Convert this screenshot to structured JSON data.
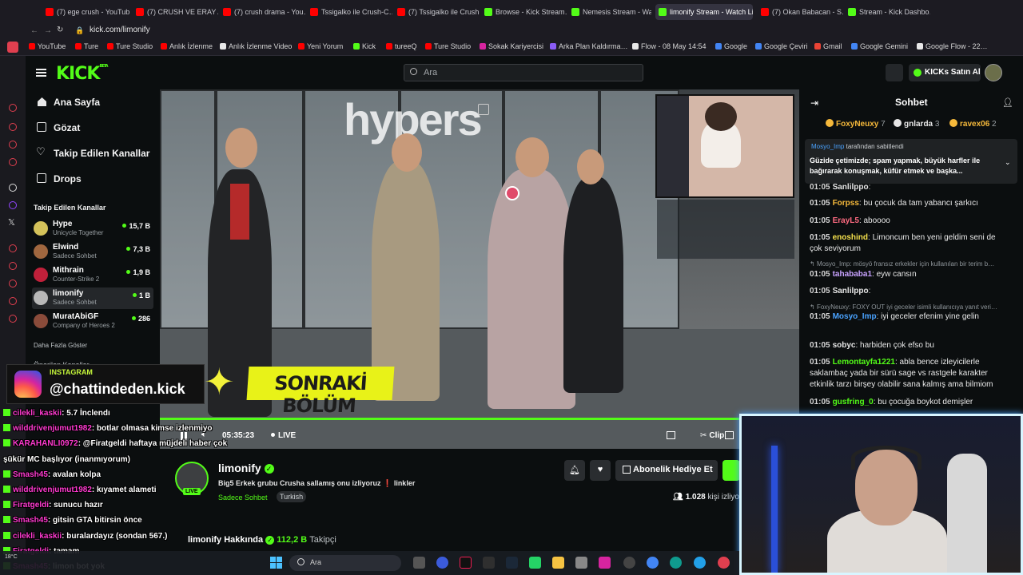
{
  "browser": {
    "tabs": [
      {
        "label": "(7) ege crush - YouTube",
        "color": "#ff0000"
      },
      {
        "label": "(7) CRUSH VE ERAY A…",
        "color": "#ff0000"
      },
      {
        "label": "(7) crush drama - You…",
        "color": "#ff0000"
      },
      {
        "label": "Tssigalko ile Crush-C…",
        "color": "#ff0000"
      },
      {
        "label": "(7) Tssigalko ile Crush…",
        "color": "#ff0000"
      },
      {
        "label": "Browse - Kick Stream…",
        "color": "#53fc18"
      },
      {
        "label": "Nemesis Stream - Wa…",
        "color": "#53fc18"
      },
      {
        "label": "limonify Stream - Watch Li…",
        "color": "#53fc18"
      },
      {
        "label": "(7) Okan Babacan - S…",
        "color": "#ff0000"
      },
      {
        "label": "Stream - Kick Dashbo…",
        "color": "#53fc18"
      }
    ],
    "url": "kick.com/limonify",
    "bookmarks": [
      {
        "label": "YouTube",
        "color": "#ff0000"
      },
      {
        "label": "Ture",
        "color": "#ff0000"
      },
      {
        "label": "Ture Studio",
        "color": "#ff0000"
      },
      {
        "label": "Anlık İzlenme",
        "color": "#ff0000"
      },
      {
        "label": "Anlık İzlenme Video",
        "color": "#e8e8e8"
      },
      {
        "label": "Yeni Yorum",
        "color": "#ff0000"
      },
      {
        "label": "Kick",
        "color": "#53fc18"
      },
      {
        "label": "tureeQ",
        "color": "#ff0000"
      },
      {
        "label": "Ture Studio",
        "color": "#ff0000"
      },
      {
        "label": "Sokak Kariyercisi",
        "color": "#d6249f"
      },
      {
        "label": "Arka Plan Kaldırma…",
        "color": "#8a5cf6"
      },
      {
        "label": "Flow - 08 May 14:54",
        "color": "#e8e8e8"
      },
      {
        "label": "Google",
        "color": "#4285f4"
      },
      {
        "label": "Google Çeviri",
        "color": "#4285f4"
      },
      {
        "label": "Gmail",
        "color": "#ea4335"
      },
      {
        "label": "Google Gemini",
        "color": "#4285f4"
      },
      {
        "label": "Google Flow - 22…",
        "color": "#e8e8e8"
      }
    ]
  },
  "header": {
    "logo": "KICK",
    "logo_badge": "BETA",
    "search_placeholder": "Ara",
    "buy_label": "KICKs Satın Al"
  },
  "sidebar": {
    "nav": [
      "Ana Sayfa",
      "Gözat",
      "Takip Edilen Kanallar",
      "Drops"
    ],
    "followed_title": "Takip Edilen Kanallar",
    "channels": [
      {
        "name": "Hype",
        "game": "Unicycle Together",
        "viewers": "15,7 B",
        "color": "#d4c25a"
      },
      {
        "name": "Elwind",
        "game": "Sadece Sohbet",
        "viewers": "7,3 B",
        "color": "#a0673f"
      },
      {
        "name": "Mithrain",
        "game": "Counter-Strike 2",
        "viewers": "1,9 B",
        "color": "#c0203a"
      },
      {
        "name": "limonify",
        "game": "Sadece Sohbet",
        "viewers": "1 B",
        "color": "#b8b8b8"
      },
      {
        "name": "MuratAbiGF",
        "game": "Company of Heroes 2",
        "viewers": "286",
        "color": "#8a4b3a"
      }
    ],
    "more": "Daha Fazla Göster",
    "suggested_title": "Önerilen Kanallar"
  },
  "player": {
    "time": "05:35:23",
    "live": "LIVE",
    "clip": "Clip",
    "banner": "SONRAKİ BÖLÜM",
    "wall_text": "hypers",
    "progress": 1.0
  },
  "overlay": {
    "insta_label": "INSTAGRAM",
    "insta_handle": "@chattindeden.kick",
    "messages": [
      {
        "user": "cilekli_kaskii",
        "text": ": 5.7 İnclendı"
      },
      {
        "user": "wilddrivenjumut1982",
        "text": ": botlar olmasa kimse izlenmiyo"
      },
      {
        "user": "KARAHANLI0972",
        "text": ": @Firatgeldi haftaya müjdeli haber çok"
      },
      {
        "user": "",
        "text": "şükür MC başlıyor (inanmıyorum)"
      },
      {
        "user": "Smash45",
        "text": ": avalan kolpa"
      },
      {
        "user": "wilddrivenjumut1982",
        "text": ": kıyamet alameti"
      },
      {
        "user": "Firatgeldi",
        "text": ": sunucu hazır"
      },
      {
        "user": "Smash45",
        "text": ": gitsin GTA bitirsin önce"
      },
      {
        "user": "cilekli_kaskii",
        "text": ": buralardayız (sondan 567.)"
      },
      {
        "user": "Firatgeldi",
        "text": ": tamam"
      },
      {
        "user": "Smash45",
        "text": ": limon bot yok"
      }
    ]
  },
  "stream": {
    "name": "limonify",
    "live_badge": "LIVE",
    "title": "Big5 Erkek grubu Crusha sallamış onu izliyoruz",
    "title_suffix": "linkler",
    "category": "Sadece Sohbet",
    "tag": "Turkish",
    "viewers": "1.028",
    "viewers_suffix": "kişi izliyor",
    "gift_label": "Abonelik Hediye Et",
    "about_label": "limonify Hakkında",
    "followers": "112,2 B",
    "followers_suffix": "Takipçi"
  },
  "chat": {
    "title": "Sohbet",
    "top": [
      {
        "name": "FoxyNeuxy",
        "count": "7"
      },
      {
        "name": "gnlarda",
        "count": "3"
      },
      {
        "name": "ravex06",
        "count": "2"
      }
    ],
    "pinned_by": "Mosyo_Imp",
    "pinned_by_suffix": "tarafından sabitlendi",
    "pinned_text": "Güzide çetimizde; spam yapmak, büyük harfler ile bağırarak konuşmak, küfür etmek ve başka...",
    "messages": [
      {
        "time": "01:05",
        "user": "Sanlilppo",
        "text": ":",
        "color": "#e6e6e6"
      },
      {
        "time": "01:05",
        "user": "Forpss",
        "text": ": bu çocuk da tam yabancı şarkıcı",
        "color": "#f6b93b"
      },
      {
        "time": "01:05",
        "user": "ErayL5",
        "text": ": aboooo",
        "color": "#ff6b81"
      },
      {
        "time": "01:05",
        "user": "enoshind",
        "text": ": Limoncum ben yeni geldim seni de çok seviyorum",
        "color": "#f4e04d"
      },
      {
        "time": "01:05",
        "user": "tahababa1",
        "text": ": eyw cansın",
        "color": "#c8a2ff"
      },
      {
        "time": "01:05",
        "user": "Sanlilppo",
        "text": ":",
        "color": "#e6e6e6"
      },
      {
        "time": "01:05",
        "user": "Mosyo_Imp",
        "text": ": iyi geceler efenim yine gelin",
        "color": "#4aa3ff"
      },
      {
        "time": "01:05",
        "user": "sobyc",
        "text": ": harbiden çok efso bu",
        "color": "#e6e6e6"
      },
      {
        "time": "01:05",
        "user": "Lemontayfa1221",
        "text": ": abla bence izleyicilerle saklambaç yada bir sürü sage vs rastgele karakter etkinlik tarzı birşey olabilir sana kalmış ama bilmiom",
        "color": "#53fc18"
      },
      {
        "time": "01:05",
        "user": "gusfring_0",
        "text": ": bu çocuğa boykot demişler",
        "color": "#53fc18"
      }
    ],
    "replies": [
      "Mosyo_Imp: mösyö fransız erkekler için kullanılan bir terim b…",
      "FoxyNeuxy: FOXY OUT iyi geceler isimli kullanıcıya yanıt veri…"
    ]
  },
  "taskbar": {
    "search": "Ara",
    "weather": "18°C"
  }
}
